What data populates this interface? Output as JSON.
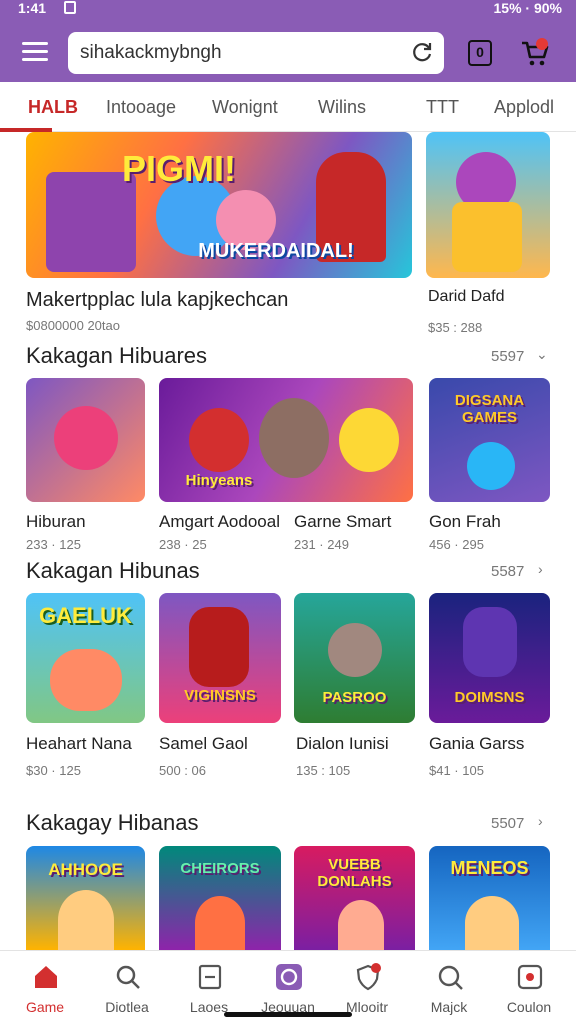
{
  "status": {
    "time": "1:41",
    "right": "15% · 90%"
  },
  "search": {
    "value": "sihakackmybngh"
  },
  "header": {
    "box_label": "0"
  },
  "tabs": [
    "HALB",
    "Intooage",
    "Wonignt",
    "Wilins",
    "TTT",
    "Applodl"
  ],
  "featured": {
    "banner_title": "PIGMI!",
    "banner_subtitle": "MUKERDAIDAL!",
    "name": "Makertpplac lula kapjkechcan",
    "price": "$0800000 20tao",
    "side_name": "Darid Dafd",
    "side_price": "$35 : 288"
  },
  "sections": [
    {
      "title": "Kakagan Hibuares",
      "count": "5597",
      "items": [
        {
          "name": "Hiburan",
          "price": "233 · 125",
          "art": ""
        },
        {
          "name": "Amgart Aodooal",
          "price": "238 · 25",
          "art": "Hinyeans"
        },
        {
          "name": "Garne Smart",
          "price": "231 · 249",
          "art": ""
        },
        {
          "name": "Gon Frah",
          "price": "456 · 295",
          "art": "DIGSANA GAMES"
        }
      ]
    },
    {
      "title": "Kakagan Hibunas",
      "count": "5587",
      "items": [
        {
          "name": "Heahart Nana",
          "price": "$30 · 125",
          "art": "GAELUK"
        },
        {
          "name": "Samel Gaol",
          "price": "500 : 06",
          "art": "VIGINSNS"
        },
        {
          "name": "Dialon Iunisi",
          "price": "135 : 105",
          "art": "PASROO"
        },
        {
          "name": "Gania Garss",
          "price": "$41 · 105",
          "art": "DOIMSNS"
        }
      ]
    },
    {
      "title": "Kakagay Hibanas",
      "count": "5507",
      "items": [
        {
          "name": "",
          "price": "",
          "art": "AHHOOE"
        },
        {
          "name": "",
          "price": "",
          "art": "CHEIRORS"
        },
        {
          "name": "",
          "price": "",
          "art": "VUEBB DONLAHS"
        },
        {
          "name": "",
          "price": "",
          "art": "MENEOS"
        }
      ]
    }
  ],
  "bottom_nav": [
    {
      "label": "Game",
      "icon": "home-icon"
    },
    {
      "label": "Diotlea",
      "icon": "search-icon"
    },
    {
      "label": "Laoes",
      "icon": "library-icon"
    },
    {
      "label": "Jeouuan",
      "icon": "profile-icon"
    },
    {
      "label": "Mlooitr",
      "icon": "shield-icon"
    },
    {
      "label": "Majck",
      "icon": "magnifier-icon"
    },
    {
      "label": "Coulon",
      "icon": "coupon-icon"
    }
  ],
  "colors": {
    "accent": "#8a5cb5",
    "active": "#d32f2f"
  }
}
